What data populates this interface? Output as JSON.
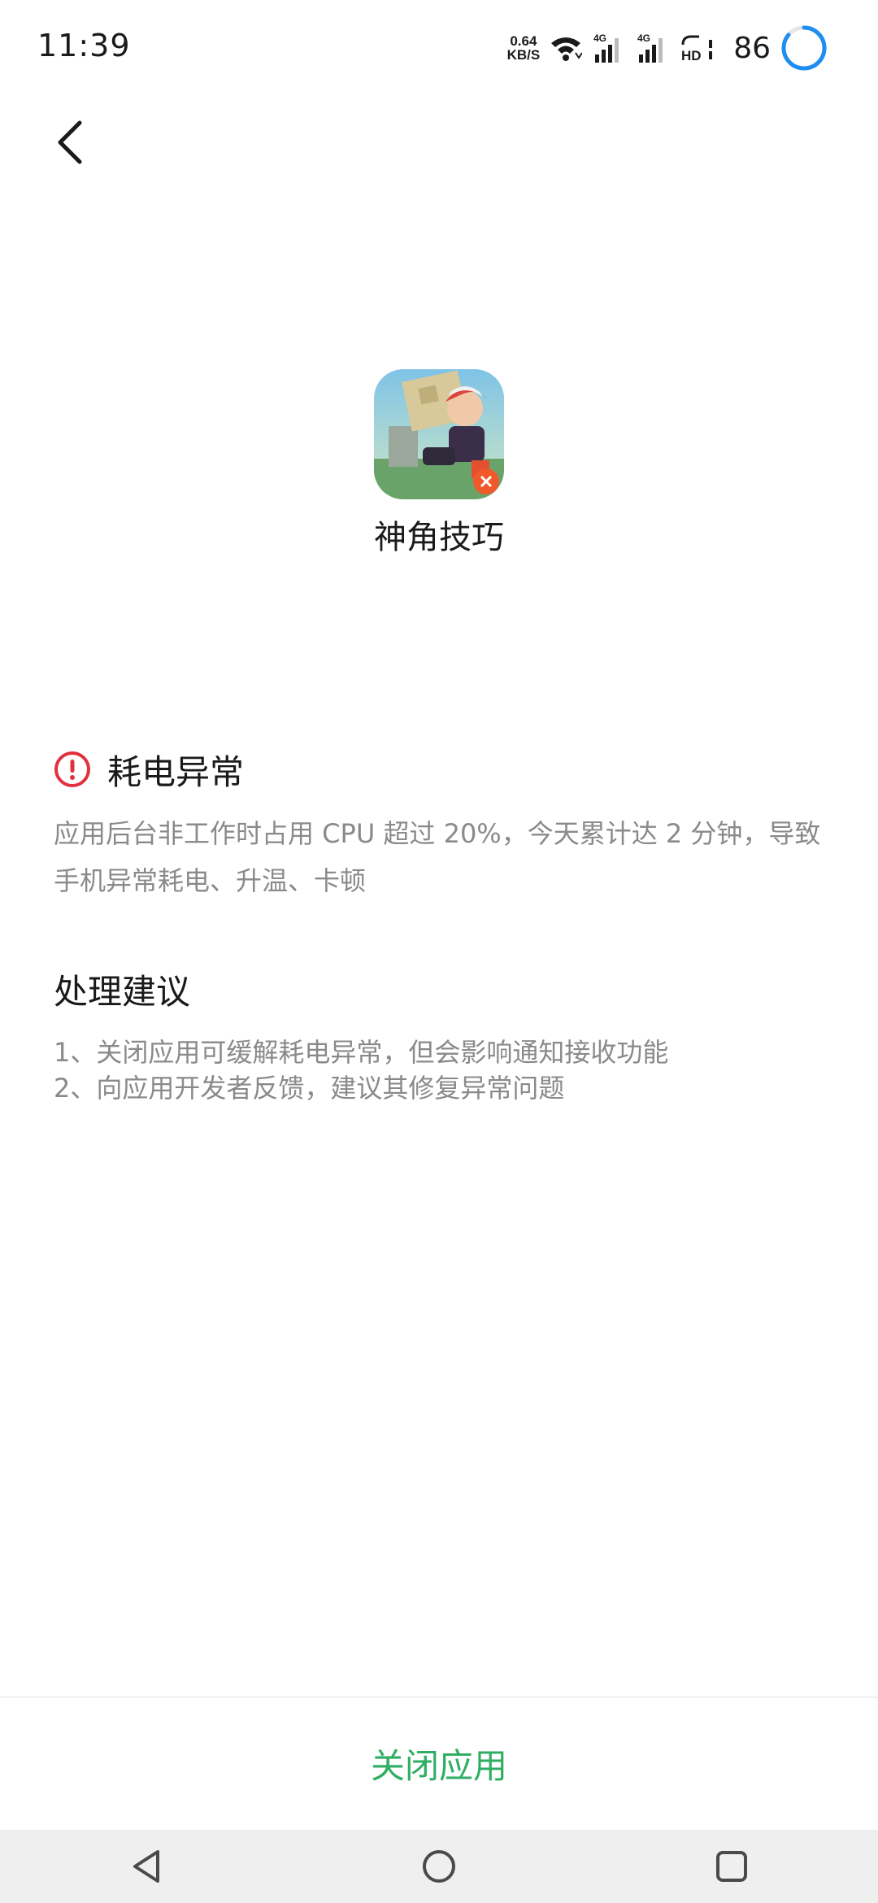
{
  "status_bar": {
    "time": "11:39",
    "net_speed_value": "0.64",
    "net_speed_unit": "KB/S",
    "signal_1_label": "4G",
    "signal_2_label": "4G",
    "hd_label": "HD",
    "battery_level": "86"
  },
  "app": {
    "name": "神角技巧"
  },
  "warning": {
    "title": "耗电异常",
    "description": "应用后台非工作时占用 CPU 超过 20%，今天累计达 2 分钟，导致手机异常耗电、升温、卡顿"
  },
  "advice": {
    "title": "处理建议",
    "items": [
      "1、关闭应用可缓解耗电异常，但会影响通知接收功能",
      "2、向应用开发者反馈，建议其修复异常问题"
    ]
  },
  "action": {
    "close_label": "关闭应用"
  },
  "colors": {
    "accent_green": "#2fae63",
    "warning_red": "#e0313f",
    "battery_blue": "#1e8ef0"
  }
}
